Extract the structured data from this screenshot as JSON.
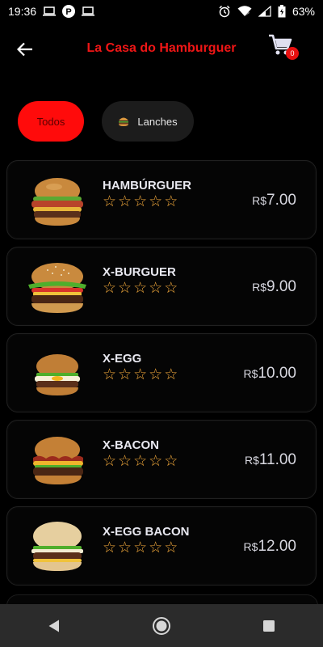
{
  "status_bar": {
    "time": "19:36",
    "battery": "63%"
  },
  "header": {
    "title": "La Casa do Hamburguer",
    "cart_count": "0"
  },
  "filters": [
    {
      "label": "Todos",
      "active": true
    },
    {
      "label": "Lanches",
      "active": false
    }
  ],
  "menu": [
    {
      "name": "HAMBÚRGUER",
      "currency": "R$",
      "price": "7.00",
      "rating": 0
    },
    {
      "name": "X-BURGUER",
      "currency": "R$",
      "price": "9.00",
      "rating": 0
    },
    {
      "name": "X-EGG",
      "currency": "R$",
      "price": "10.00",
      "rating": 0
    },
    {
      "name": "X-BACON",
      "currency": "R$",
      "price": "11.00",
      "rating": 0
    },
    {
      "name": "X-EGG BACON",
      "currency": "R$",
      "price": "12.00",
      "rating": 0
    }
  ],
  "colors": {
    "accent": "#ff0b0b",
    "title": "#f01616",
    "star": "#f2a93b",
    "background": "#000000"
  }
}
